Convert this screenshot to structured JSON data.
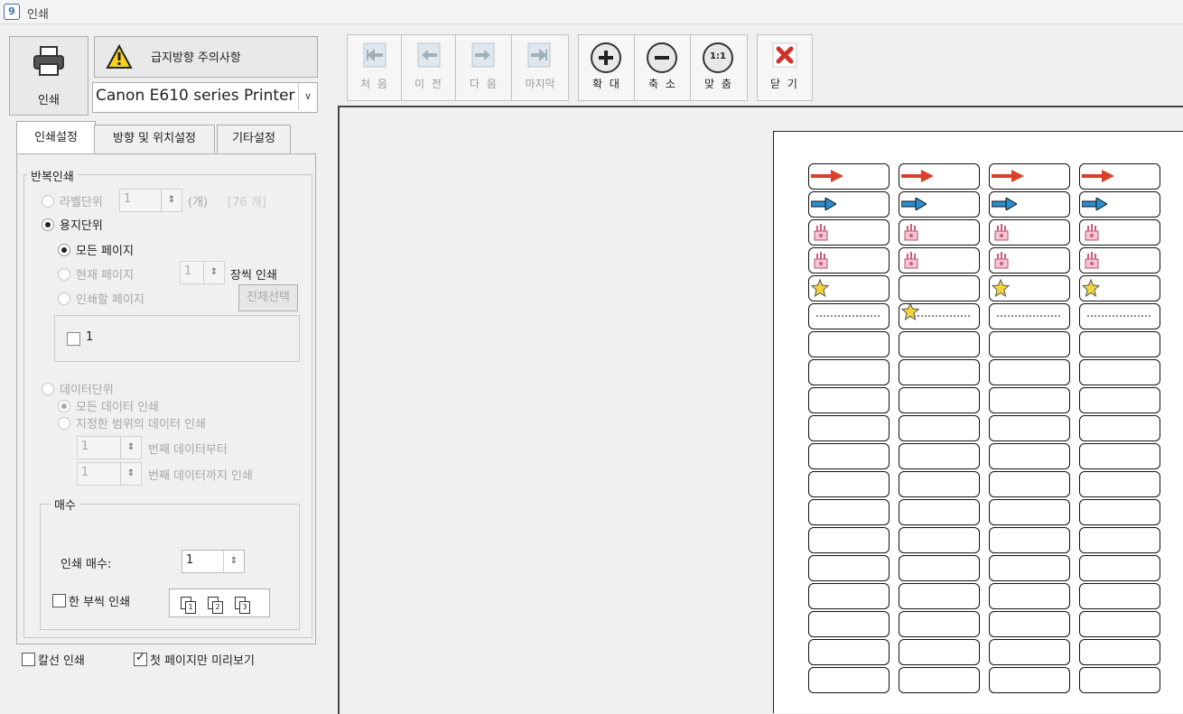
{
  "window": {
    "app_icon": "9",
    "title": "인쇄"
  },
  "left": {
    "print_label": "인쇄",
    "warn_label": "급지방향 주의사항",
    "printer": "Canon E610 series Printer",
    "tabs": [
      "인쇄설정",
      "방향 및 위치설정",
      "기타설정"
    ],
    "repeat_group": "반복인쇄",
    "label_unit": "라벨단위",
    "label_unit_value": "1",
    "label_unit_suffix": "(개)",
    "label_total": "[76 개]",
    "paper_unit": "용지단위",
    "all_pages": "모든 페이지",
    "current_page": "현재 페이지",
    "current_page_value": "1",
    "sheets_print": "장씩 인쇄",
    "pages_to_print": "인쇄할 페이지",
    "select_all": "전체선택",
    "page_item": "1",
    "data_unit": "데이터단위",
    "all_data": "모든 데이터 인쇄",
    "range_data": "지정한 범위의 데이터 인쇄",
    "range_from_value": "1",
    "range_from_label": "번째 데이터부터",
    "range_to_value": "1",
    "range_to_label": "번째 데이터까지 인쇄",
    "copies_group": "매수",
    "copies_label": "인쇄 매수:",
    "copies_value": "1",
    "collate_label": "한 부씩 인쇄",
    "collate_nums": [
      "1",
      "2",
      "3"
    ],
    "cutline_label": "칼선 인쇄",
    "first_page_preview": "첫 페이지만 미리보기"
  },
  "toolbar": {
    "first": "처 음",
    "prev": "이 전",
    "next": "다 음",
    "last": "마지막",
    "zoom_in": "확 대",
    "zoom_out": "축 소",
    "fit": "맞 춤",
    "fit_icon": "1:1",
    "close": "닫 기"
  },
  "preview": {
    "columns": 4,
    "rows": 19,
    "filled_rows": [
      [
        "red-arrow",
        "red-arrow",
        "red-arrow",
        "red-arrow"
      ],
      [
        "blue-arrow",
        "blue-arrow",
        "blue-arrow",
        "blue-arrow"
      ],
      [
        "cake",
        "cake",
        "cake",
        "cake"
      ],
      [
        "cake",
        "cake",
        "cake",
        "cake"
      ],
      [
        "star",
        "",
        "star",
        "star"
      ],
      [
        "dots",
        "star-dots",
        "dots",
        "dots"
      ]
    ]
  }
}
